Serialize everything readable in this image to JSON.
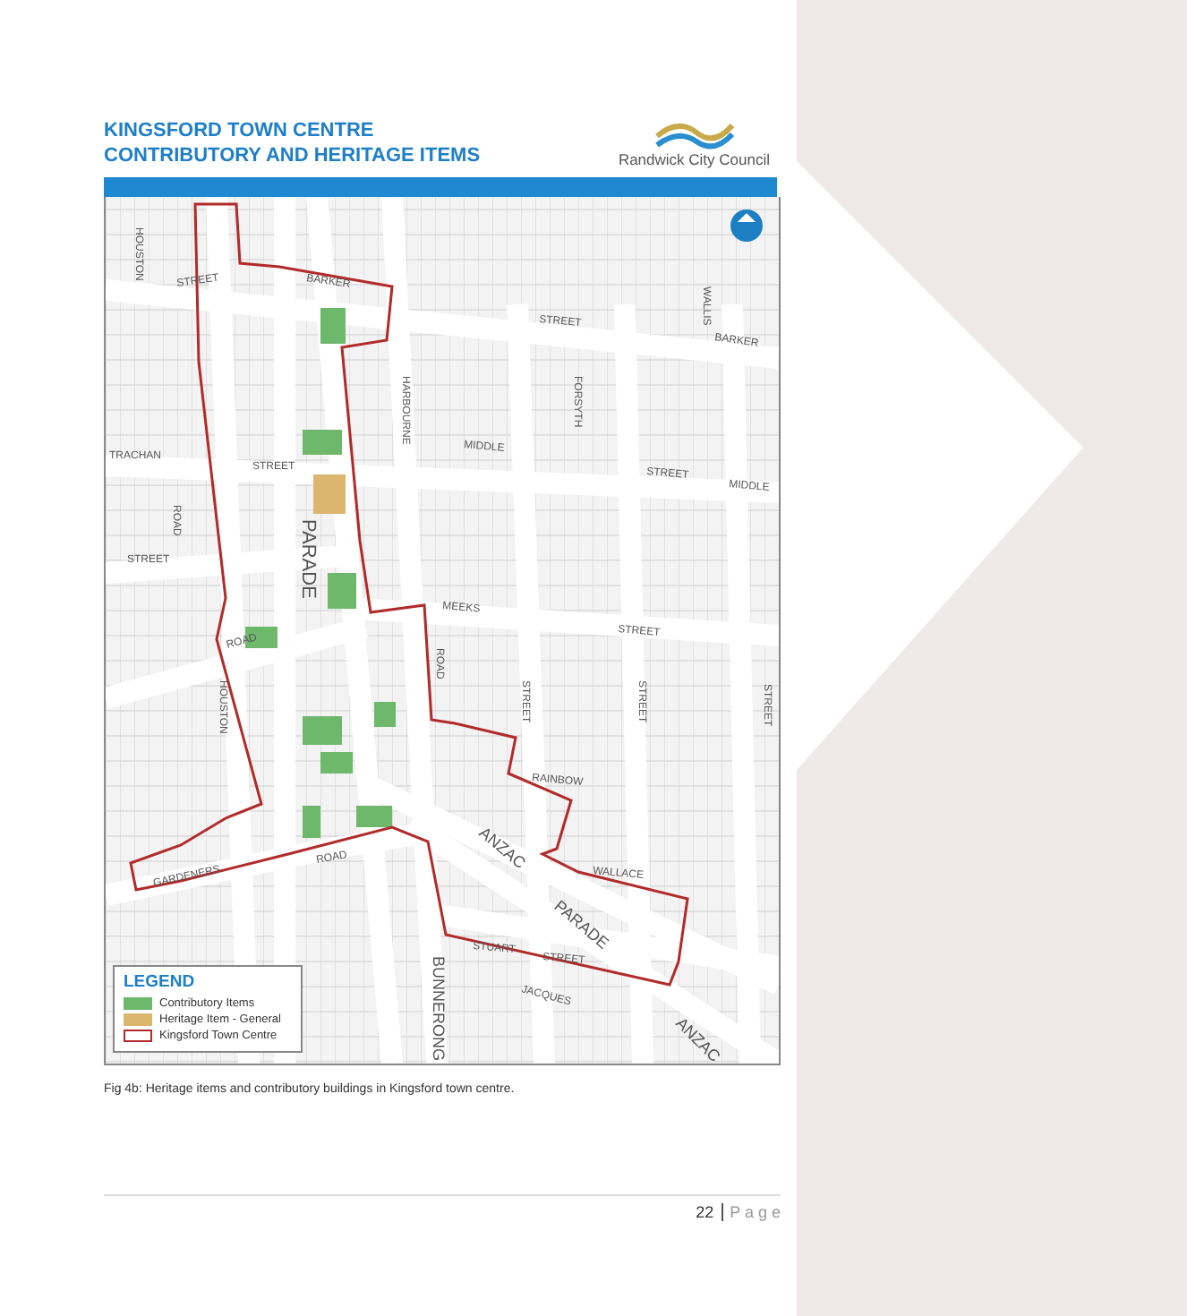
{
  "header": {
    "title_lines": [
      "KINGSFORD TOWN CENTRE",
      "CONTRIBUTORY AND HERITAGE ITEMS"
    ],
    "logo_text": "Randwick City Council"
  },
  "map": {
    "street_labels": [
      "HOUSTON",
      "STREET",
      "BARKER",
      "STREET",
      "BARKER",
      "WALLIS",
      "HARBOURNE",
      "FORSYTH",
      "MIDDLE",
      "STREET",
      "MIDDLE",
      "TRACHAN",
      "STREET",
      "PARADE",
      "ROAD",
      "STREET",
      "MEEKS",
      "STREET",
      "ROAD",
      "ROAD",
      "STREET",
      "STREET",
      "STREET",
      "HOUSTON",
      "RAINBOW",
      "ANZAC",
      "WALLACE",
      "PARADE",
      "GARDENERS",
      "ROAD",
      "STUART",
      "STREET",
      "BUNNERONG",
      "JACQUES",
      "ANZAC"
    ],
    "legend": {
      "title": "LEGEND",
      "items": [
        {
          "label": "Contributory Items",
          "kind": "fill",
          "color": "#6db86b"
        },
        {
          "label": "Heritage Item - General",
          "kind": "fill",
          "color": "#dcb56e"
        },
        {
          "label": "Kingsford Town Centre",
          "kind": "outline",
          "color": "#b22a2a"
        }
      ]
    }
  },
  "caption": "Fig 4b: Heritage items and contributory buildings in Kingsford town centre.",
  "footer": {
    "page_number": "22",
    "page_word": "P a g e"
  }
}
